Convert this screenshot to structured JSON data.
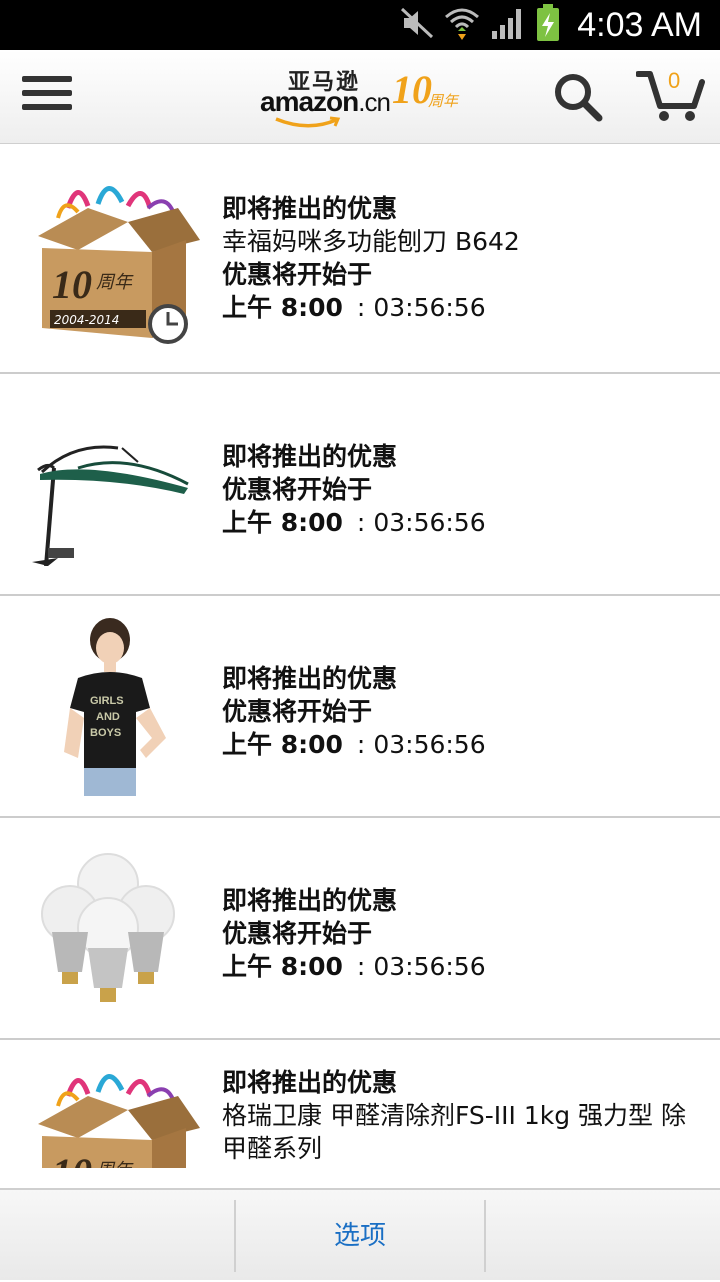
{
  "status_bar": {
    "time": "4:03 AM",
    "icons": [
      "mute-icon",
      "wifi-icon",
      "signal-icon",
      "battery-charging-icon"
    ]
  },
  "header": {
    "logo_cn": "亚马逊",
    "logo_en": "amazon",
    "logo_suffix": ".cn",
    "anniversary_number": "10",
    "anniversary_label": "周年",
    "cart_count": "0",
    "accent_color": "#f0a21a"
  },
  "deals": [
    {
      "heading": "即将推出的优惠",
      "name": "幸福妈咪多功能刨刀 B642",
      "starts_label": "优惠将开始于",
      "start_time": "上午 8:00",
      "separator": ":",
      "countdown": "03:56:56",
      "image": "anniversary-box"
    },
    {
      "heading": "即将推出的优惠",
      "name": "",
      "starts_label": "优惠将开始于",
      "start_time": "上午 8:00",
      "separator": ":",
      "countdown": "03:56:56",
      "image": "umbrella"
    },
    {
      "heading": "即将推出的优惠",
      "name": "",
      "starts_label": "优惠将开始于",
      "start_time": "上午 8:00",
      "separator": ":",
      "countdown": "03:56:56",
      "image": "tshirt-model",
      "shirt_text": [
        "GIRLS",
        "AND",
        "BOYS"
      ]
    },
    {
      "heading": "即将推出的优惠",
      "name": "",
      "starts_label": "优惠将开始于",
      "start_time": "上午 8:00",
      "separator": ":",
      "countdown": "03:56:56",
      "image": "led-bulbs"
    },
    {
      "heading": "即将推出的优惠",
      "name": "格瑞卫康 甲醛清除剂FS-III 1kg 强力型 除甲醛系列",
      "image": "anniversary-box"
    }
  ],
  "box_label": {
    "number": "10",
    "text": "周年",
    "years": "2004-2014"
  },
  "bottom_bar": {
    "options_label": "选项",
    "options_color": "#1a6fc4"
  }
}
